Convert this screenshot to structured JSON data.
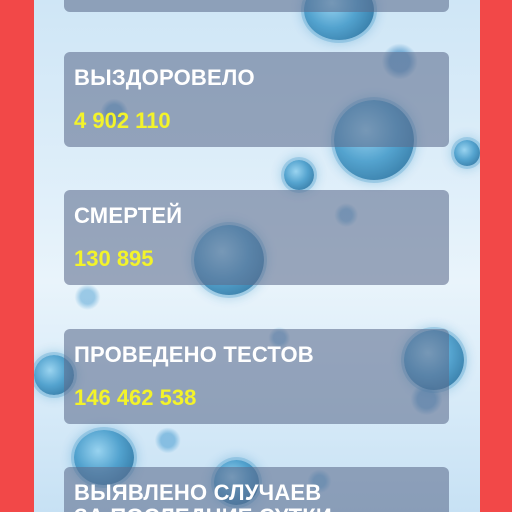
{
  "stats": {
    "recovered": {
      "label": "ВЫЗДОРОВЕЛО",
      "value": "4 902 110"
    },
    "deaths": {
      "label": "СМЕРТЕЙ",
      "value": "130 895"
    },
    "tests": {
      "label": "ПРОВЕДЕНО ТЕСТОВ",
      "value": "146 462 538"
    },
    "new_cases": {
      "label_line1": "ВЫЯВЛЕНО СЛУЧАЕВ",
      "label_line2": "ЗА ПОСЛЕДНИЕ СУТКИ"
    }
  },
  "colors": {
    "frame": "#f24848",
    "card": "#5d6c8e",
    "label": "#ffffff",
    "value": "#f3f32a"
  }
}
